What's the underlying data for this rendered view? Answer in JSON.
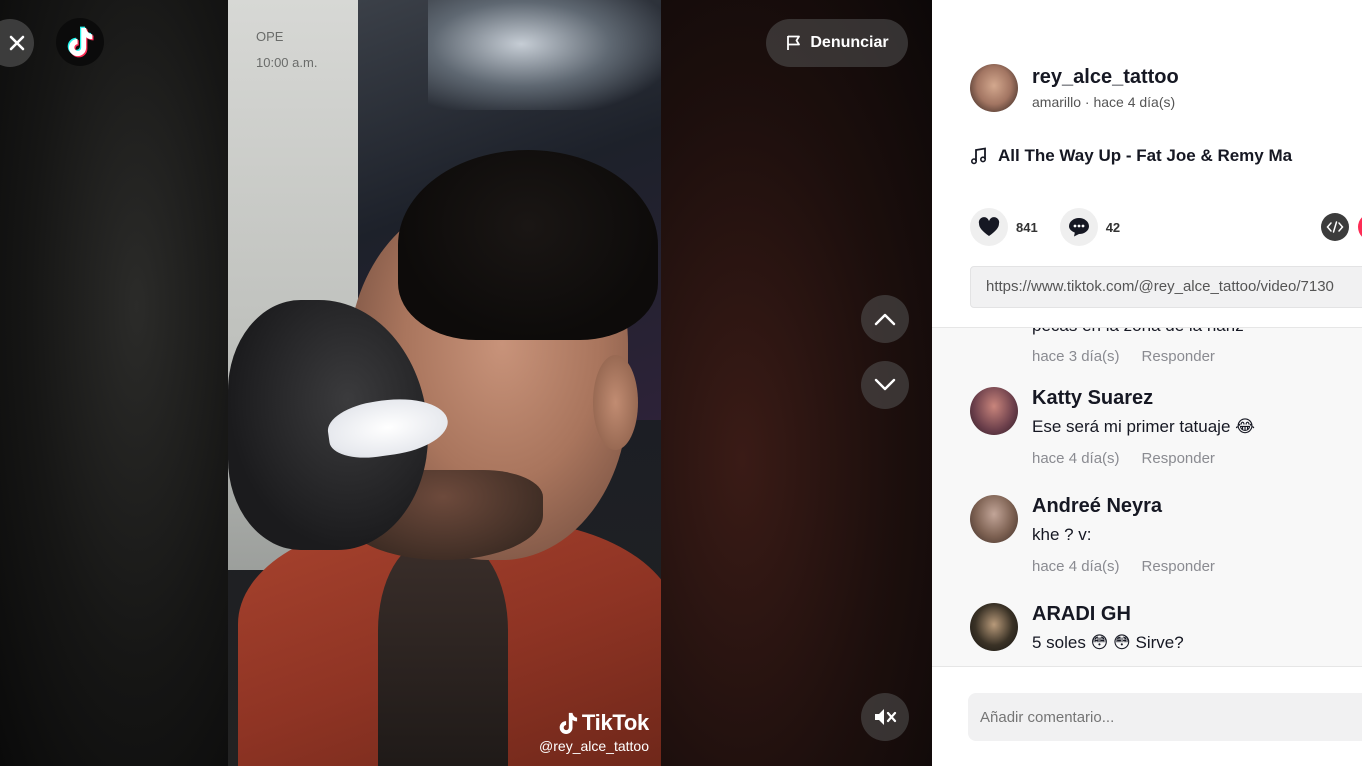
{
  "video": {
    "wall_text_1": "OPE",
    "wall_text_2": "10:00 a.m.",
    "watermark_brand": "TikTok",
    "watermark_user": "@rey_alce_tattoo",
    "report_label": "Denunciar"
  },
  "author": {
    "username": "rey_alce_tattoo",
    "meta": "amarillo · hace 4 día(s)"
  },
  "music": {
    "title": "All The Way Up - Fat Joe & Remy Ma"
  },
  "stats": {
    "likes": "841",
    "comments": "42"
  },
  "link": {
    "url": "https://www.tiktok.com/@rey_alce_tattoo/video/7130"
  },
  "comments": {
    "cut_text": "pecas en la zona de la nariz",
    "first_meta": {
      "time": "hace 3 día(s)",
      "reply": "Responder"
    },
    "items": [
      {
        "name": "Katty Suarez",
        "text": "Ese será mi primer tatuaje 😂",
        "time": "hace 4 día(s)",
        "reply": "Responder",
        "avatar_color": "#6a3e4a"
      },
      {
        "name": "Andreé Neyra",
        "text": "khe ? v:",
        "time": "hace 4 día(s)",
        "reply": "Responder",
        "avatar_color": "#7d6152"
      },
      {
        "name": "ARADI GH",
        "text": "5 soles 😳 😳 Sirve?",
        "time": "",
        "reply": "",
        "avatar_color": "#3a3226"
      }
    ]
  },
  "input": {
    "placeholder": "Añadir comentario..."
  },
  "colors": {
    "accent": "#fe2c55",
    "text": "#161823",
    "muted": "#8a8b91"
  }
}
